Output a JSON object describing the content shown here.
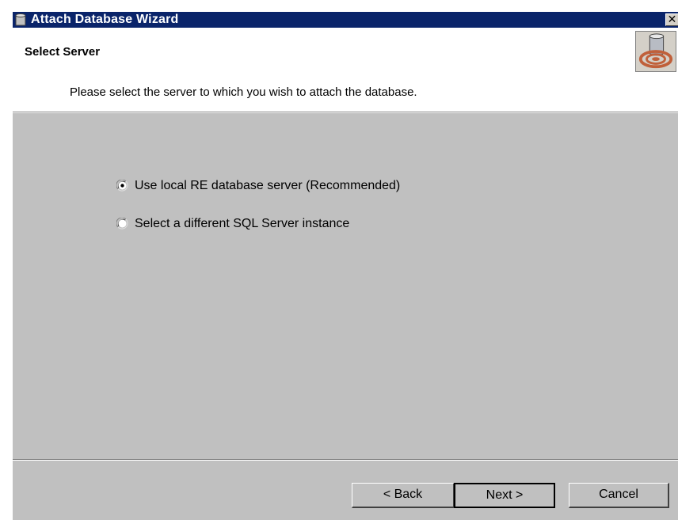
{
  "window": {
    "title": "Attach Database Wizard",
    "close_label": "✕"
  },
  "header": {
    "heading": "Select Server",
    "subheading": "Please select the server to which you wish to attach the database."
  },
  "options": [
    {
      "label": "Use local RE database server (Recommended)",
      "checked": true
    },
    {
      "label": "Select a different SQL Server instance",
      "checked": false
    }
  ],
  "buttons": {
    "back": "< Back",
    "next": "Next >",
    "cancel": "Cancel"
  },
  "colors": {
    "titlebar": "#0a246a",
    "dialog": "#c0c0c0",
    "header": "#ffffff"
  }
}
